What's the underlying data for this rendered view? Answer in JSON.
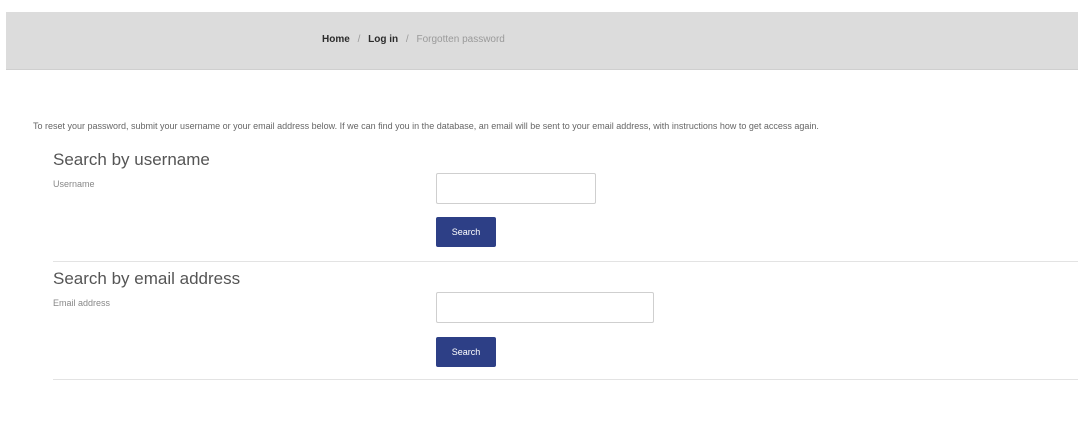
{
  "breadcrumb": {
    "items": [
      "Home",
      "Log in"
    ],
    "separator": "/",
    "current": "Forgotten password"
  },
  "intro_text": "To reset your password, submit your username or your email address below. If we can find you in the database, an email will be sent to your email address, with instructions how to get access again.",
  "username_section": {
    "title": "Search by username",
    "label": "Username",
    "value": "",
    "button_label": "Search"
  },
  "email_section": {
    "title": "Search by email address",
    "label": "Email address",
    "value": "",
    "button_label": "Search"
  },
  "colors": {
    "breadcrumb_bar": "#dcdcdc",
    "button": "#2d3f86",
    "button_text": "#ffffff"
  }
}
